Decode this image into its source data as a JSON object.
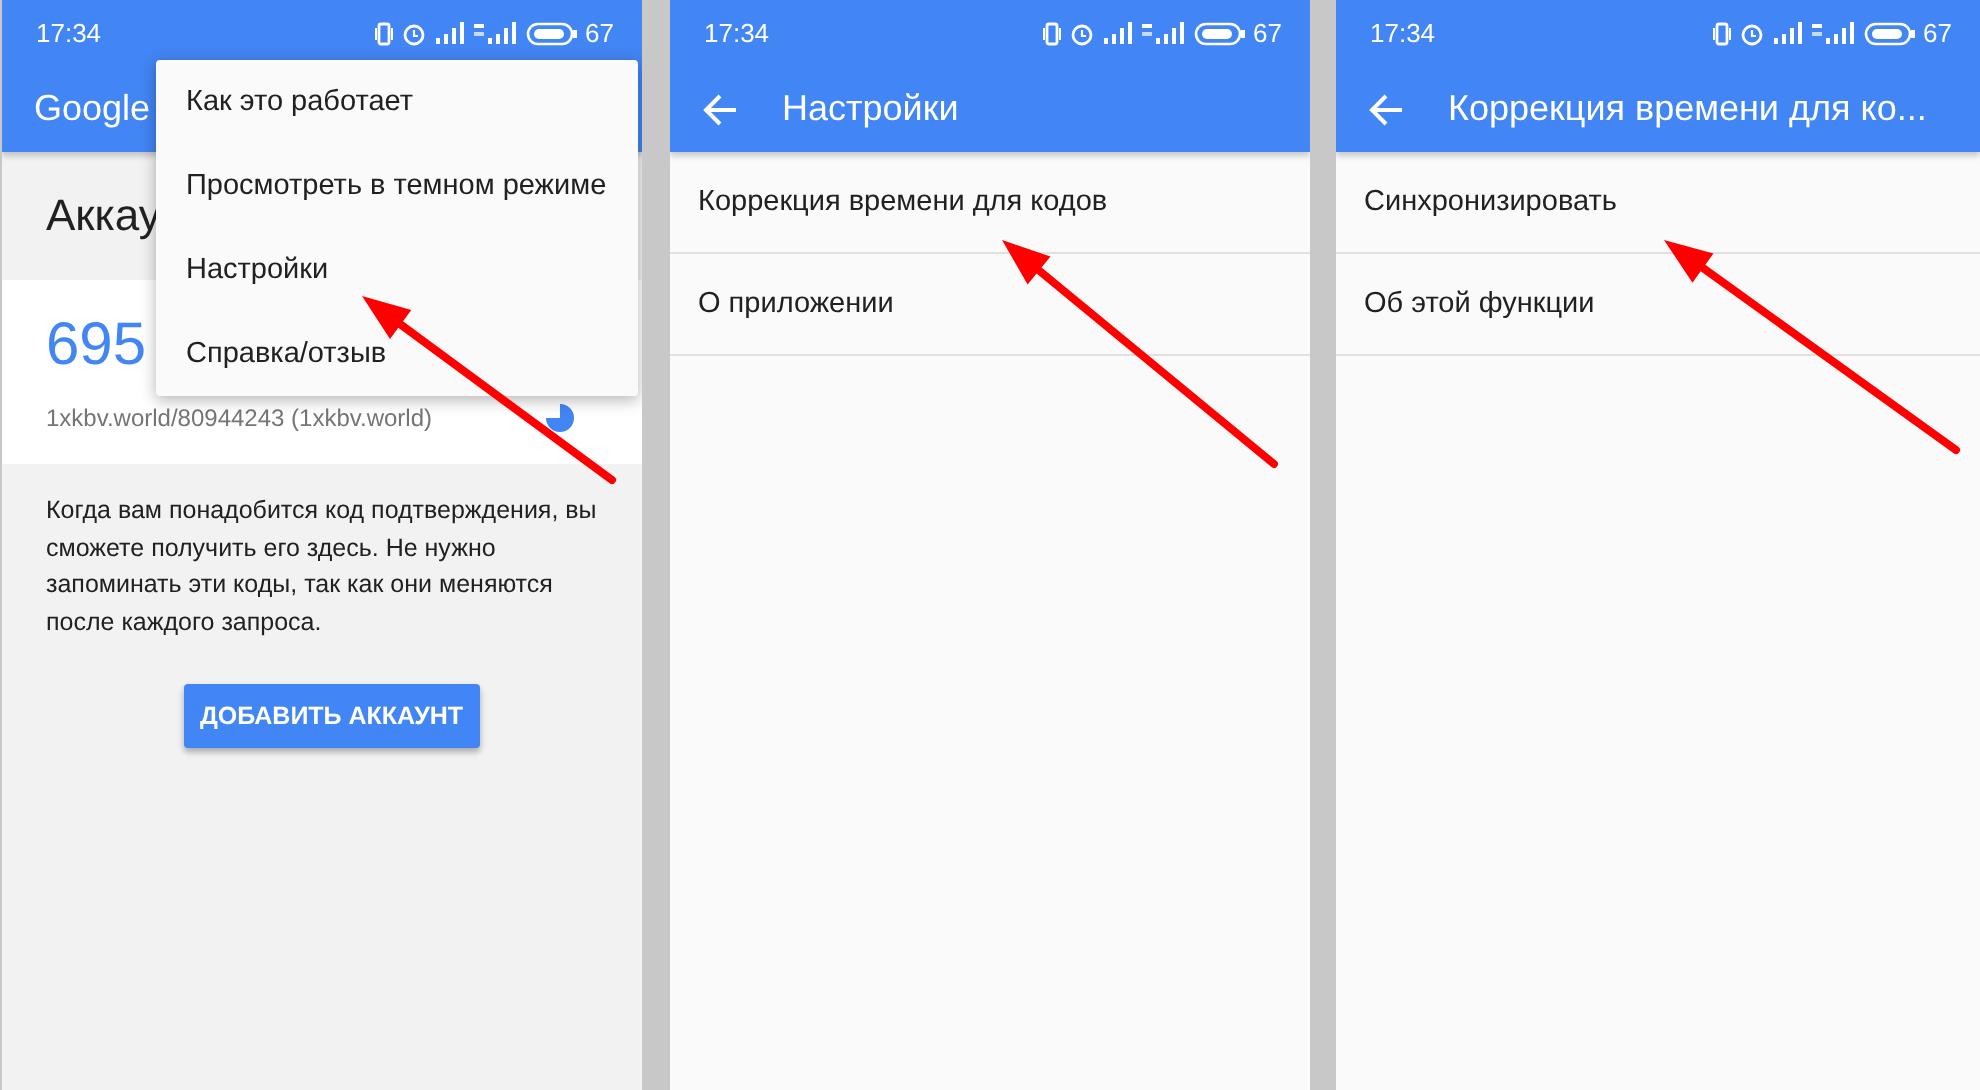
{
  "screens": [
    {
      "kind": "main",
      "status": {
        "time": "17:34",
        "battery": "67"
      },
      "title": "Google",
      "section_title": "Аккау",
      "account": {
        "code": "695",
        "name": "1xkbv.world/80944243 (1xkbv.world)"
      },
      "hint": "Когда вам понадобится код подтверждения, вы сможете получить его здесь. Не нужно запоминать эти коды, так как они меняются после каждого запроса.",
      "button": "ДОБАВИТЬ АККАУНТ",
      "menu": [
        {
          "label": "Как это работает"
        },
        {
          "label": "Просмотреть в темном режиме"
        },
        {
          "label": "Настройки"
        },
        {
          "label": "Справка/отзыв"
        }
      ]
    },
    {
      "kind": "list",
      "status": {
        "time": "17:34",
        "battery": "67"
      },
      "title": "Настройки",
      "items": [
        {
          "label": "Коррекция времени для кодов"
        },
        {
          "label": "О приложении"
        }
      ]
    },
    {
      "kind": "list",
      "status": {
        "time": "17:34",
        "battery": "67"
      },
      "title": "Коррекция времени для ко...",
      "items": [
        {
          "label": "Синхронизировать"
        },
        {
          "label": "Об этой функции"
        }
      ]
    }
  ]
}
